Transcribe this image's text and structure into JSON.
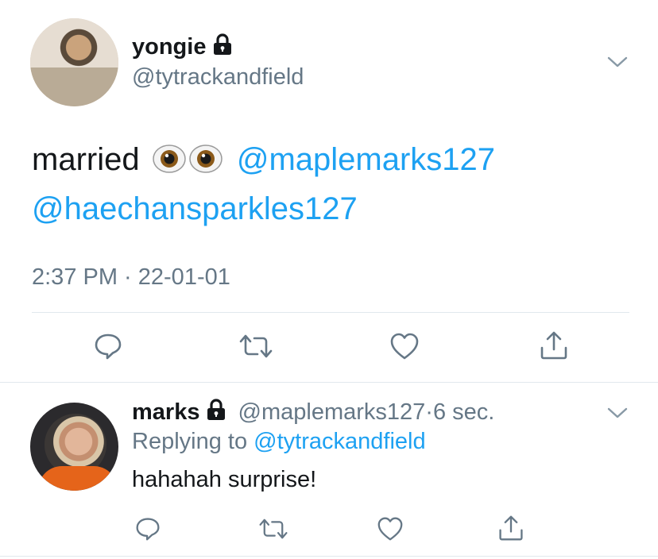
{
  "main_tweet": {
    "author": {
      "display_name": "yongie",
      "handle": "@tytrackandfield",
      "protected": true
    },
    "text": {
      "word": "married",
      "emojis": [
        "eyes-emoji",
        "eyes-emoji"
      ],
      "mention_1": "@maplemarks127",
      "mention_2": "@haechansparkles127"
    },
    "timestamp": "2:37 PM · 22-01-01"
  },
  "reply_tweet": {
    "author": {
      "display_name": "marks",
      "handle": "@maplemarks127",
      "protected": true
    },
    "age": "6 sec.",
    "replying_prefix": "Replying to",
    "replying_to": "@tytrackandfield",
    "text": "hahahah surprise!"
  },
  "actions": [
    "comment-icon",
    "retweet-icon",
    "like-icon",
    "share-icon"
  ],
  "colors": {
    "text": "#14171a",
    "secondary": "#657786",
    "link": "#1da1f2",
    "divider": "#e1e8ed"
  }
}
